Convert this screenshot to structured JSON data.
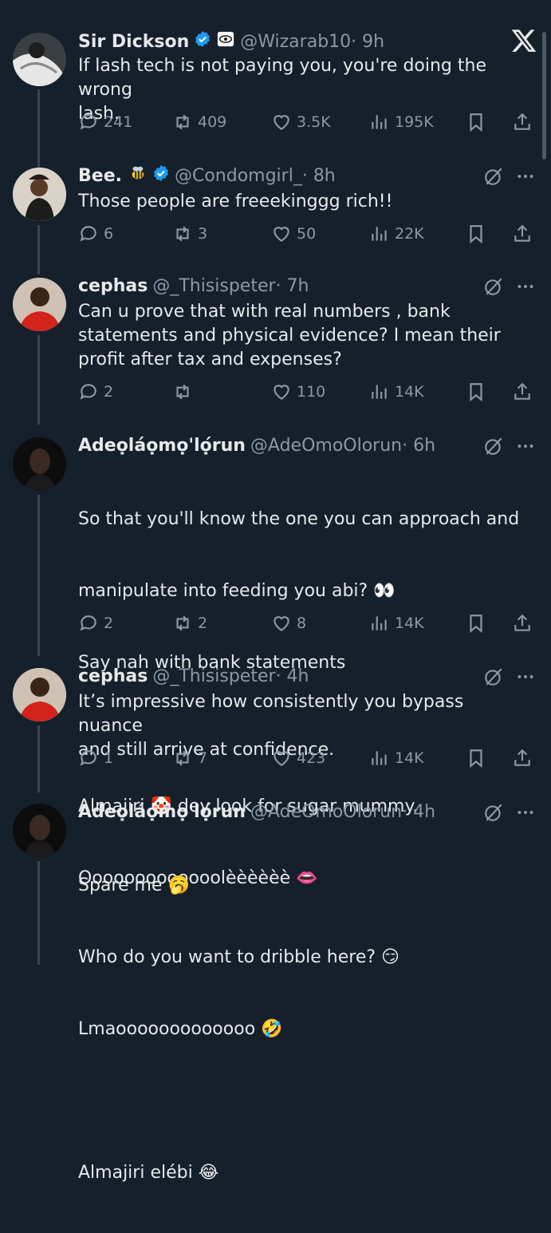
{
  "tweets": [
    {
      "name": "Sir Dickson",
      "handle": "@Wizarab10",
      "time": "· 9h",
      "text": "If lash tech is not paying you, you're doing the wrong\nlash.",
      "replies": "241",
      "reposts": "409",
      "likes": "3.5K",
      "views": "195K"
    },
    {
      "name": "Bee.",
      "handle": "@Condomgirl_",
      "time": "· 8h",
      "text": "Those people are freeekinggg rich!!",
      "replies": "6",
      "reposts": "3",
      "likes": "50",
      "views": "22K"
    },
    {
      "name": "cephas",
      "handle": "@_Thisispeter",
      "time": "· 7h",
      "text": "Can u prove that with real numbers , bank\nstatements and physical evidence? I mean their\nprofit after tax and expenses?",
      "replies": "2",
      "reposts": "",
      "likes": "110",
      "views": "14K"
    },
    {
      "name": "Adeọláọmọ'lọ́run",
      "handle": "@AdeOmoOlorun",
      "time": "· 6h",
      "text_lines": [
        "So that you'll know the one you can approach and",
        "manipulate into feeding you abi? 👀",
        "Say nah with bank statements",
        "",
        "Almajiri 🤡 dey look for sugar mummy.",
        "Ooooooooooooolèèèèèè 👄"
      ],
      "replies": "2",
      "reposts": "2",
      "likes": "8",
      "views": "14K"
    },
    {
      "name": "cephas",
      "handle": "@_Thisispeter",
      "time": "· 4h",
      "text": "It’s impressive how consistently you bypass nuance\nand still arrive at confidence.",
      "replies": "1",
      "reposts": "7",
      "likes": "423",
      "views": "14K"
    },
    {
      "name": "Adeọláọmọ'lọ́run",
      "handle": "@AdeOmoOlorun",
      "time": "· 4h",
      "text_lines": [
        "Spare me 🥱",
        "Who do you want to dribble here? 😏",
        "Lmaooooooooooooo 🤣",
        "",
        "Almajiri elébi 😂"
      ]
    }
  ],
  "colors": {
    "bg": "#15202b",
    "muted": "#8b98a5",
    "verified": "#1d9bf0",
    "text": "#e7e9ea"
  },
  "icons": [
    "reply-icon",
    "repost-icon",
    "like-icon",
    "views-icon",
    "bookmark-icon",
    "share-icon",
    "grok-icon",
    "more-icon",
    "x-logo-icon",
    "verified-icon"
  ]
}
